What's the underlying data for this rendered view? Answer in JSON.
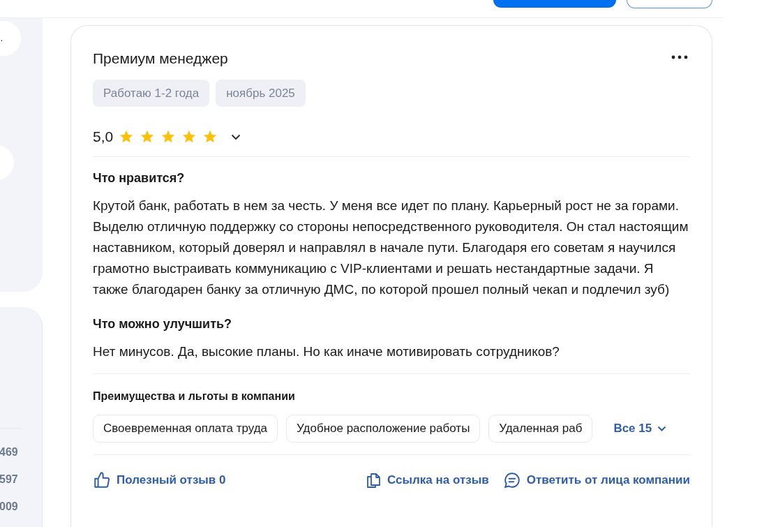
{
  "sidebar": {
    "top_text": ".",
    "numbers": [
      "469",
      "597",
      "009"
    ]
  },
  "review": {
    "title": "Премиум менеджер",
    "tags": [
      "Работаю 1-2 года",
      "ноябрь 2025"
    ],
    "rating": "5,0",
    "stars": 5,
    "sections": [
      {
        "heading": "Что нравится?",
        "text": "Крутой банк, работать в нем за честь. У меня все идет по плану. Карьерный рост не за горами. Выделю отличную поддержку со стороны непосредственного руководителя. Он стал настоящим наставником, который доверял и направлял в начале пути. Благодаря его советам я научился грамотно выстраивать коммуникацию с VIP-клиентами и решать нестандартные задачи. Я также благодарен банку за отличную ДМС, по которой прошел полный чекап и подлечил зуб)"
      },
      {
        "heading": "Что можно улучшить?",
        "text": "Нет минусов. Да, высокие планы. Но как иначе мотивировать сотрудников?"
      }
    ],
    "benefits_title": "Преимущества и льготы в компании",
    "benefits": [
      "Своевременная оплата труда",
      "Удобное расположение работы",
      "Удаленная раб"
    ],
    "benefits_more": "Все 15",
    "actions": [
      {
        "kind": "like",
        "label": "Полезный отзыв 0"
      },
      {
        "kind": "link",
        "label": "Ссылка на отзыв"
      },
      {
        "kind": "reply",
        "label": "Ответить от лица компании"
      }
    ]
  }
}
